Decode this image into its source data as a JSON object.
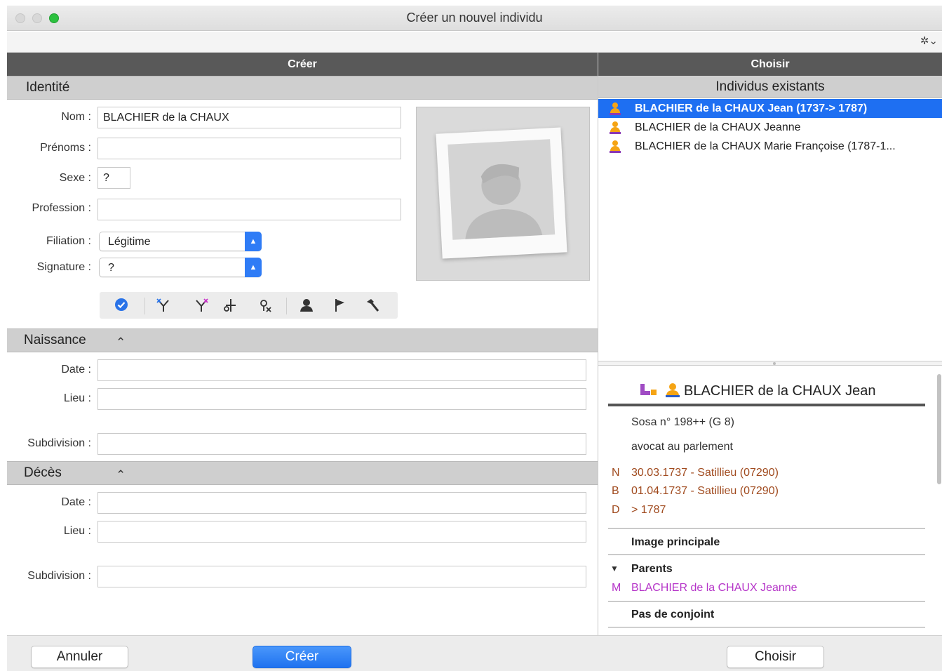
{
  "window": {
    "title": "Créer un nouvel individu"
  },
  "columns": {
    "left": "Créer",
    "right": "Choisir"
  },
  "identity": {
    "section": "Identité",
    "nom_label": "Nom :",
    "nom_value": "BLACHIER de la CHAUX",
    "prenoms_label": "Prénoms :",
    "prenoms_value": "",
    "sexe_label": "Sexe :",
    "sexe_value": "?",
    "profession_label": "Profession :",
    "profession_value": "",
    "filiation_label": "Filiation :",
    "filiation_value": "Légitime",
    "signature_label": "Signature :",
    "signature_value": "?"
  },
  "naissance": {
    "section": "Naissance",
    "date_label": "Date :",
    "date_value": "",
    "lieu_label": "Lieu :",
    "lieu_value": "",
    "subdivision_label": "Subdivision :",
    "subdivision_value": ""
  },
  "deces": {
    "section": "Décès",
    "date_label": "Date :",
    "date_value": "",
    "lieu_label": "Lieu :",
    "lieu_value": "",
    "subdivision_label": "Subdivision :",
    "subdivision_value": ""
  },
  "list": {
    "title": "Individus existants",
    "items": [
      {
        "label": "BLACHIER de la CHAUX Jean (1737-> 1787)",
        "selected": true
      },
      {
        "label": "BLACHIER de la CHAUX Jeanne",
        "selected": false
      },
      {
        "label": "BLACHIER de la CHAUX Marie Françoise (1787-1...",
        "selected": false
      }
    ]
  },
  "detail": {
    "name": "BLACHIER de la CHAUX Jean",
    "sosa": "Sosa n° 198++ (G 8)",
    "profession": "avocat au parlement",
    "events": [
      {
        "code": "N",
        "text": "30.03.1737 - Satillieu (07290)"
      },
      {
        "code": "B",
        "text": "01.04.1737 - Satillieu (07290)"
      },
      {
        "code": "D",
        "text": "> 1787"
      }
    ],
    "image_principale": "Image principale",
    "parents_title": "Parents",
    "parent_code": "M",
    "parent_name": "BLACHIER de la CHAUX Jeanne",
    "conjoint": "Pas de conjoint"
  },
  "buttons": {
    "cancel": "Annuler",
    "create": "Créer",
    "choose": "Choisir"
  },
  "colors": {
    "accent": "#1e6ff2",
    "event": "#a04a1e",
    "parent": "#b534c8"
  }
}
